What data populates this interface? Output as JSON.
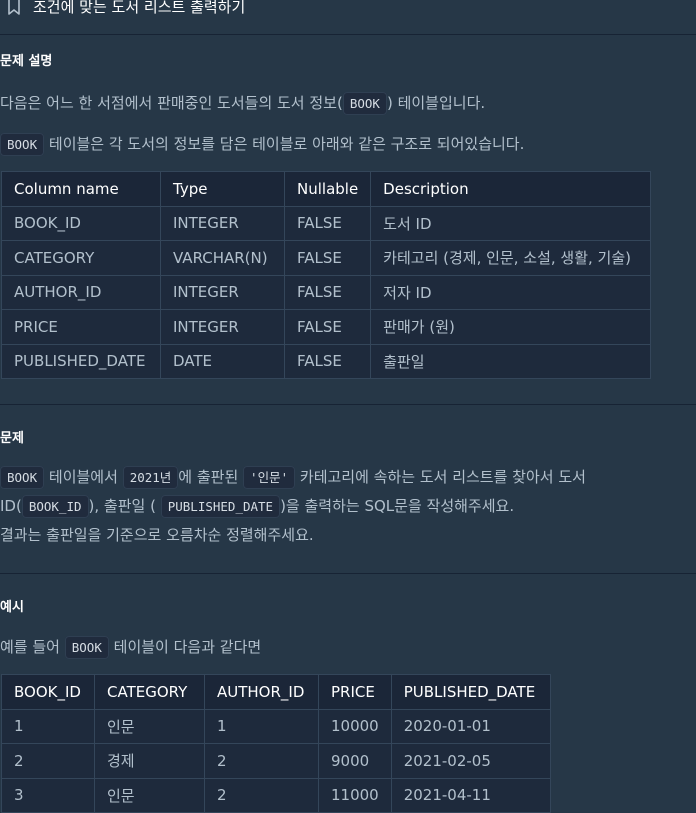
{
  "header": {
    "title": "조건에 맞는 도서 리스트 출력하기"
  },
  "description": {
    "heading": "문제 설명",
    "line1_pre": "다음은 어느 한 서점에서 판매중인 도서들의 도서 정보(",
    "line1_code": "BOOK",
    "line1_post": ") 테이블입니다.",
    "line2_code": "BOOK",
    "line2_post": "테이블은 각 도서의 정보를 담은 테이블로 아래와 같은 구조로 되어있습니다."
  },
  "schema_table": {
    "headers": [
      "Column name",
      "Type",
      "Nullable",
      "Description"
    ],
    "rows": [
      [
        "BOOK_ID",
        "INTEGER",
        "FALSE",
        "도서 ID"
      ],
      [
        "CATEGORY",
        "VARCHAR(N)",
        "FALSE",
        "카테고리 (경제, 인문, 소설, 생활, 기술)"
      ],
      [
        "AUTHOR_ID",
        "INTEGER",
        "FALSE",
        "저자 ID"
      ],
      [
        "PRICE",
        "INTEGER",
        "FALSE",
        "판매가 (원)"
      ],
      [
        "PUBLISHED_DATE",
        "DATE",
        "FALSE",
        "출판일"
      ]
    ]
  },
  "problem": {
    "heading": "문제",
    "code1": "BOOK",
    "text1": "테이블에서",
    "code2": "2021년",
    "text2": "에 출판된",
    "code3": "'인문'",
    "text3": "카테고리에 속하는 도서 리스트를 찾아서 도서",
    "text4": "ID(",
    "code4": "BOOK_ID",
    "text5": "), 출판일 (",
    "code5": "PUBLISHED_DATE",
    "text6": ")을 출력하는 SQL문을 작성해주세요.",
    "line3": "결과는 출판일을 기준으로 오름차순 정렬해주세요."
  },
  "example": {
    "heading": "예시",
    "text_pre": "예를 들어",
    "code": "BOOK",
    "text_post": "테이블이 다음과 같다면"
  },
  "example_table": {
    "headers": [
      "BOOK_ID",
      "CATEGORY",
      "AUTHOR_ID",
      "PRICE",
      "PUBLISHED_DATE"
    ],
    "rows": [
      [
        "1",
        "인문",
        "1",
        "10000",
        "2020-01-01"
      ],
      [
        "2",
        "경제",
        "2",
        "9000",
        "2021-02-05"
      ],
      [
        "3",
        "인문",
        "2",
        "11000",
        "2021-04-11"
      ]
    ]
  }
}
